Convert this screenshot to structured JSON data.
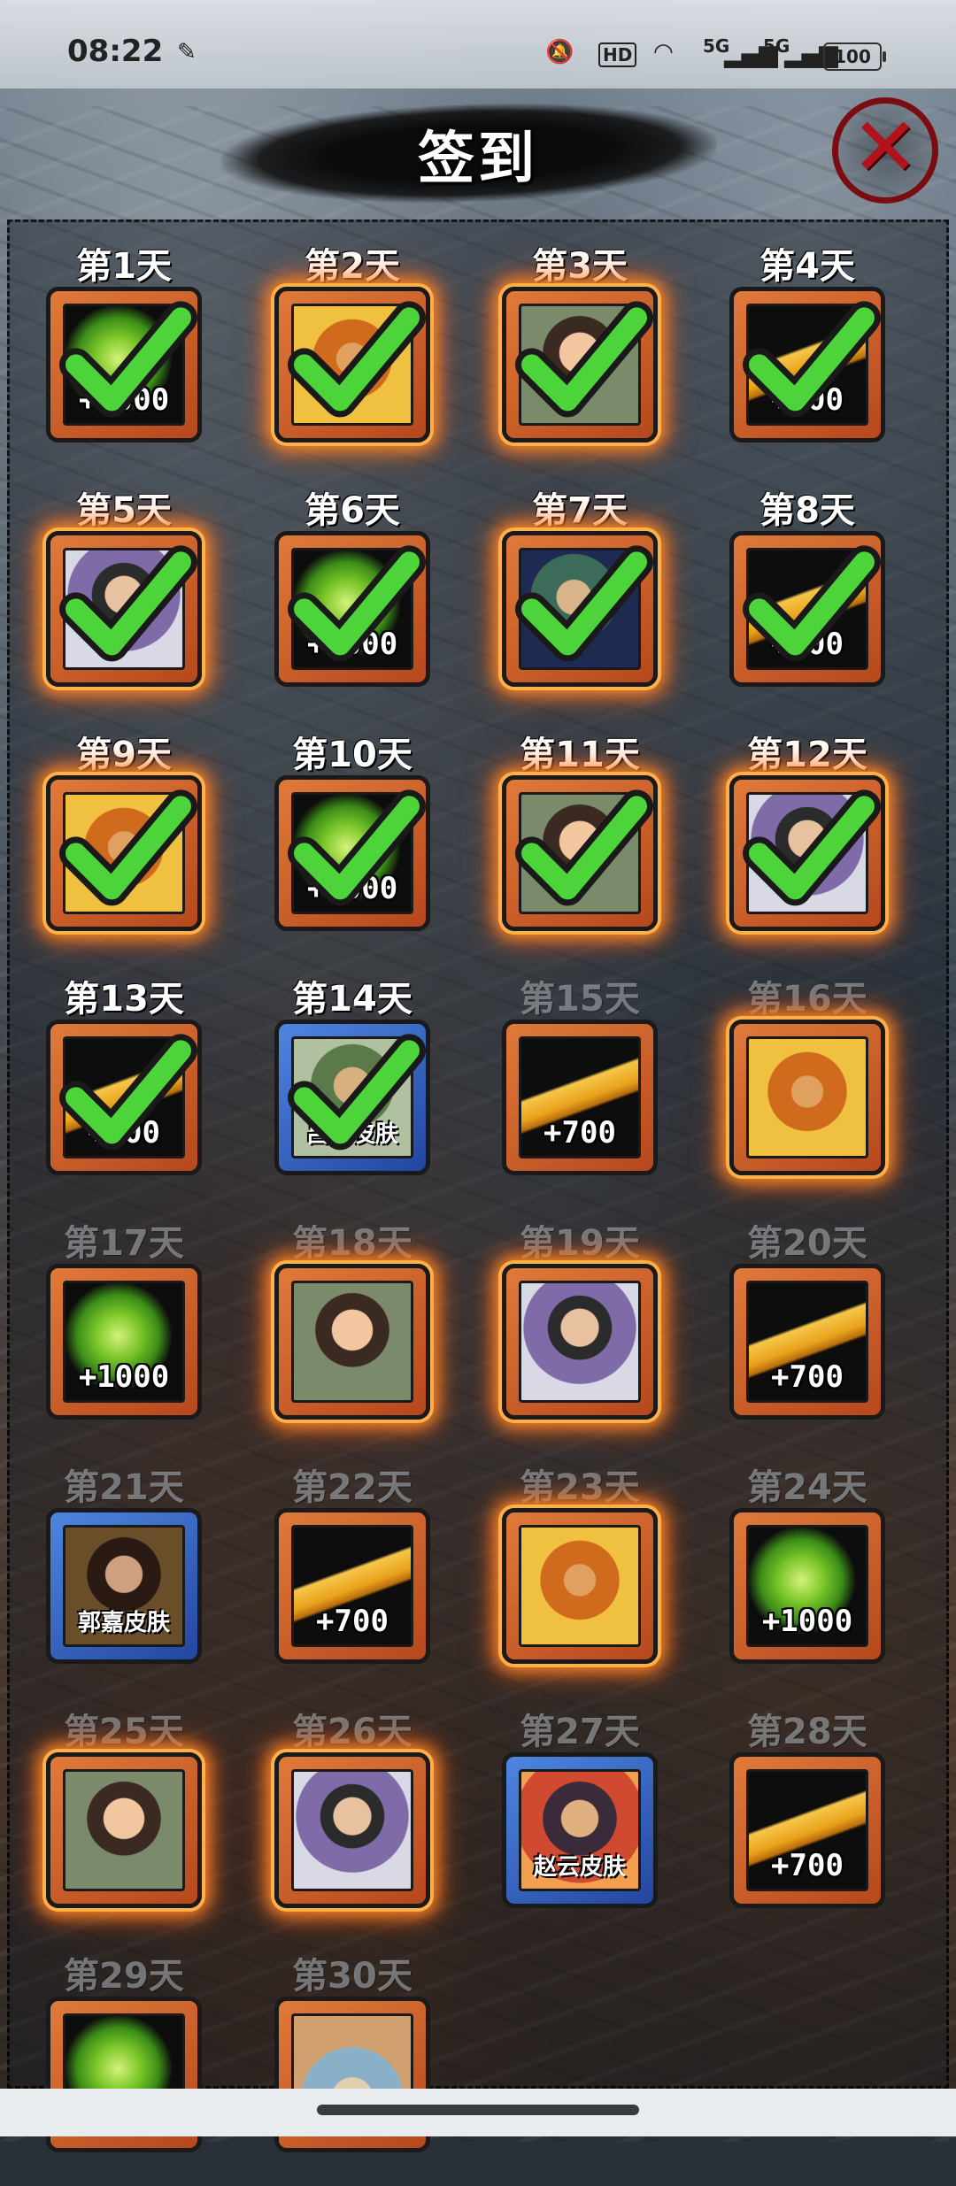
{
  "status_bar": {
    "time": "08:22",
    "network_1": "5G",
    "network_2": "5G",
    "battery": "100",
    "hd_badge": "HD"
  },
  "header": {
    "title": "签到",
    "close_icon": "close-x-icon"
  },
  "days": [
    {
      "label": "第1天",
      "reward": "gem",
      "text": "+1000",
      "frame": "orange",
      "glow": false,
      "claimed": true
    },
    {
      "label": "第2天",
      "reward": "portrait-c",
      "text": "",
      "frame": "orange",
      "glow": true,
      "claimed": true
    },
    {
      "label": "第3天",
      "reward": "portrait-a",
      "text": "",
      "frame": "orange",
      "glow": true,
      "claimed": true
    },
    {
      "label": "第4天",
      "reward": "gold",
      "text": "+700",
      "frame": "orange",
      "glow": false,
      "claimed": true
    },
    {
      "label": "第5天",
      "reward": "portrait-b",
      "text": "",
      "frame": "orange",
      "glow": true,
      "claimed": true
    },
    {
      "label": "第6天",
      "reward": "gem",
      "text": "+1000",
      "frame": "orange",
      "glow": false,
      "claimed": true
    },
    {
      "label": "第7天",
      "reward": "portrait-d",
      "text": "",
      "frame": "orange",
      "glow": true,
      "claimed": true
    },
    {
      "label": "第8天",
      "reward": "gold",
      "text": "+700",
      "frame": "orange",
      "glow": false,
      "claimed": true
    },
    {
      "label": "第9天",
      "reward": "portrait-c",
      "text": "",
      "frame": "orange",
      "glow": true,
      "claimed": true
    },
    {
      "label": "第10天",
      "reward": "gem",
      "text": "+1000",
      "frame": "orange",
      "glow": false,
      "claimed": true
    },
    {
      "label": "第11天",
      "reward": "portrait-a",
      "text": "",
      "frame": "orange",
      "glow": true,
      "claimed": true
    },
    {
      "label": "第12天",
      "reward": "portrait-b",
      "text": "",
      "frame": "orange",
      "glow": true,
      "claimed": true
    },
    {
      "label": "第13天",
      "reward": "gold",
      "text": "+700",
      "frame": "orange",
      "glow": false,
      "claimed": true
    },
    {
      "label": "第14天",
      "reward": "portrait-g",
      "text": "吕布皮肤",
      "frame": "blue",
      "glow": false,
      "claimed": true
    },
    {
      "label": "第15天",
      "reward": "gold",
      "text": "+700",
      "frame": "orange",
      "glow": false,
      "claimed": false
    },
    {
      "label": "第16天",
      "reward": "portrait-c",
      "text": "",
      "frame": "orange",
      "glow": true,
      "claimed": false
    },
    {
      "label": "第17天",
      "reward": "gem",
      "text": "+1000",
      "frame": "orange",
      "glow": false,
      "claimed": false
    },
    {
      "label": "第18天",
      "reward": "portrait-a",
      "text": "",
      "frame": "orange",
      "glow": true,
      "claimed": false
    },
    {
      "label": "第19天",
      "reward": "portrait-b",
      "text": "",
      "frame": "orange",
      "glow": true,
      "claimed": false
    },
    {
      "label": "第20天",
      "reward": "gold",
      "text": "+700",
      "frame": "orange",
      "glow": false,
      "claimed": false
    },
    {
      "label": "第21天",
      "reward": "portrait-e",
      "text": "郭嘉皮肤",
      "frame": "blue",
      "glow": false,
      "claimed": false
    },
    {
      "label": "第22天",
      "reward": "gold",
      "text": "+700",
      "frame": "orange",
      "glow": false,
      "claimed": false
    },
    {
      "label": "第23天",
      "reward": "portrait-c",
      "text": "",
      "frame": "orange",
      "glow": true,
      "claimed": false
    },
    {
      "label": "第24天",
      "reward": "gem",
      "text": "+1000",
      "frame": "orange",
      "glow": false,
      "claimed": false
    },
    {
      "label": "第25天",
      "reward": "portrait-a",
      "text": "",
      "frame": "orange",
      "glow": true,
      "claimed": false
    },
    {
      "label": "第26天",
      "reward": "portrait-b",
      "text": "",
      "frame": "orange",
      "glow": true,
      "claimed": false
    },
    {
      "label": "第27天",
      "reward": "portrait-f",
      "text": "赵云皮肤",
      "frame": "blue",
      "glow": false,
      "claimed": false
    },
    {
      "label": "第28天",
      "reward": "gold",
      "text": "+700",
      "frame": "orange",
      "glow": false,
      "claimed": false
    },
    {
      "label": "第29天",
      "reward": "gem",
      "text": "",
      "frame": "orange",
      "glow": false,
      "claimed": false
    },
    {
      "label": "第30天",
      "reward": "portrait-h",
      "text": "",
      "frame": "orange",
      "glow": false,
      "claimed": false
    }
  ],
  "colors": {
    "frame_orange": "#d2622a",
    "frame_blue": "#3a66c8",
    "glow": "#ff8c28",
    "check_green": "#4cd43a",
    "close_red": "#b3121b"
  }
}
